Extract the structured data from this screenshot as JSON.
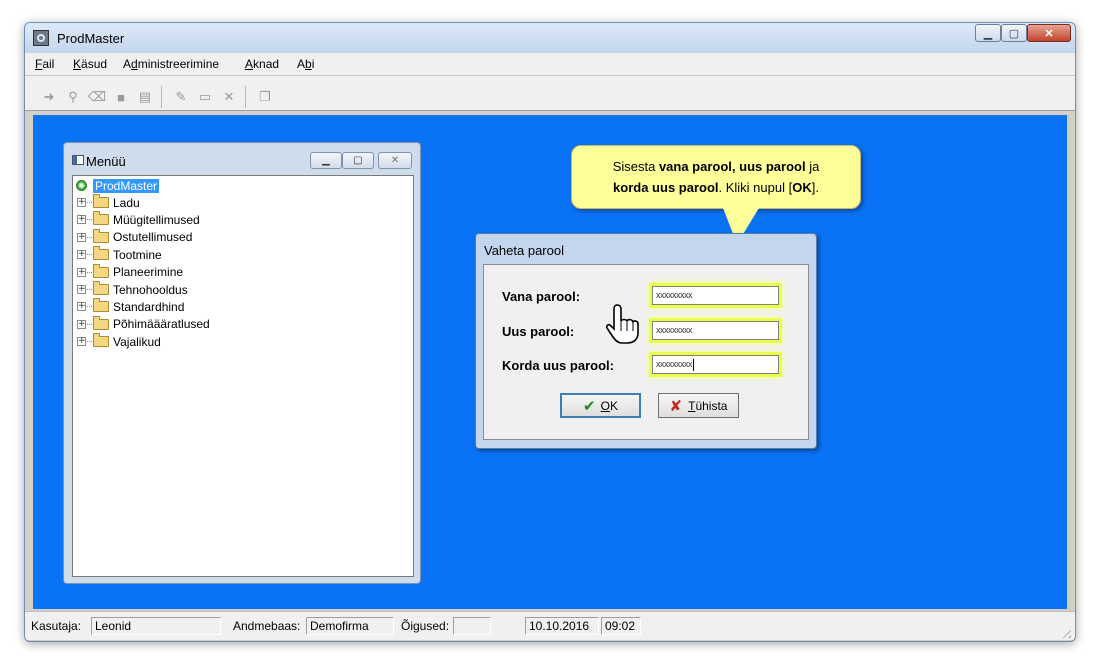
{
  "window": {
    "title": "ProdMaster",
    "close_glyph": "✕",
    "minimize_glyph": "▁",
    "maximize_glyph": "▢"
  },
  "menubar": {
    "items": [
      {
        "label": "Fail",
        "mnemonic": "F"
      },
      {
        "label": "Käsud",
        "mnemonic": "K"
      },
      {
        "label": "Administreerimine",
        "mnemonic": "d"
      },
      {
        "label": "Aknad",
        "mnemonic": "A"
      },
      {
        "label": "Abi",
        "mnemonic": "b"
      }
    ]
  },
  "toolbar": {
    "icons": [
      "login-icon",
      "find-icon",
      "eraser-icon",
      "stop-icon",
      "page-icon",
      "new-doc-icon",
      "open-folder-icon",
      "delete-icon",
      "copy-window-icon"
    ]
  },
  "menu_window": {
    "title": "Menüü",
    "tree": {
      "root": "ProdMaster",
      "items": [
        "Ladu",
        "Müügitellimused",
        "Ostutellimused",
        "Tootmine",
        "Planeerimine",
        "Tehnohooldus",
        "Standardhind",
        "Põhimäääratlused",
        "Vajalikud"
      ]
    }
  },
  "callout": {
    "parts": [
      {
        "text": "Sisesta ",
        "bold": false
      },
      {
        "text": "vana parool, uus parool",
        "bold": true
      },
      {
        "text": " ja ",
        "bold": false
      },
      {
        "text": "korda uus parool",
        "bold": true
      },
      {
        "text": ". Kliki nupul [",
        "bold": false
      },
      {
        "text": "OK",
        "bold": true
      },
      {
        "text": "].",
        "bold": false
      }
    ]
  },
  "dialog": {
    "title": "Vaheta parool",
    "fields": [
      {
        "label": "Vana parool:",
        "value": "xxxxxxxxx"
      },
      {
        "label": "Uus parool:",
        "value": "xxxxxxxxx"
      },
      {
        "label": "Korda uus parool:",
        "value": "xxxxxxxxx"
      }
    ],
    "ok_label": "OK",
    "ok_mnemonic": "O",
    "cancel_label": "Tühista",
    "cancel_mnemonic": "T"
  },
  "statusbar": {
    "user_label": "Kasutaja:",
    "user_value": "Leonid",
    "db_label": "Andmebaas:",
    "db_value": "Demofirma",
    "rights_label": "Õigused:",
    "rights_value": "",
    "date": "10.10.2016",
    "time": "09:02"
  },
  "colors": {
    "desktop": "#0a72f4",
    "callout": "#ffff99",
    "highlight": "#eaff4a",
    "selection": "#3399ff"
  }
}
